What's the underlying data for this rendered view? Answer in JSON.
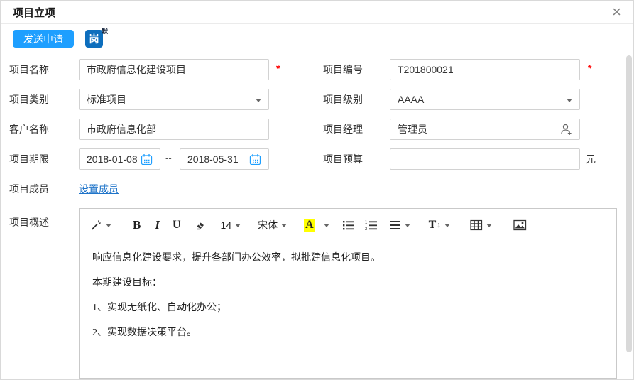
{
  "window": {
    "title": "项目立项",
    "close_icon": "×"
  },
  "toolbar": {
    "send_label": "发送申请",
    "post_icon_char": "岗",
    "post_icon_badge": "默"
  },
  "form": {
    "name": {
      "label": "项目名称",
      "value": "市政府信息化建设项目",
      "required": "*"
    },
    "code": {
      "label": "项目编号",
      "value": "T201800021",
      "required": "*"
    },
    "category": {
      "label": "项目类别",
      "value": "标准项目"
    },
    "level": {
      "label": "项目级别",
      "value": "AAAA"
    },
    "customer": {
      "label": "客户名称",
      "value": "市政府信息化部"
    },
    "manager": {
      "label": "项目经理",
      "value": "管理员"
    },
    "period": {
      "label": "项目期限",
      "start": "2018-01-08",
      "separator": "--",
      "end": "2018-05-31"
    },
    "budget": {
      "label": "项目预算",
      "value": "",
      "unit": "元"
    },
    "members": {
      "label": "项目成员",
      "link": "设置成员"
    },
    "overview": {
      "label": "项目概述"
    }
  },
  "editor": {
    "toolbar": {
      "bold": "B",
      "italic": "I",
      "underline": "U",
      "font_size": "14",
      "font_family": "宋体",
      "color_letter": "A",
      "lineheight_letter": "T",
      "lineheight_arrow": "↕"
    },
    "content": [
      "响应信息化建设要求，提升各部门办公效率，拟批建信息化项目。",
      "本期建设目标：",
      "1、实现无纸化、自动化办公；",
      "2、实现数据决策平台。"
    ]
  },
  "icons": {
    "wand": "magic-wand-icon",
    "eraser": "eraser-icon",
    "bullet": "bullet-list-icon",
    "numbered": "numbered-list-icon",
    "align": "align-icon",
    "table": "table-icon",
    "image": "image-icon",
    "calendar": "calendar-icon",
    "person_add": "person-add-icon"
  },
  "colors": {
    "accent": "#1E9FFF",
    "post_icon_blue": "#0d6ebd",
    "link": "#1f74c9",
    "required": "#ff0000",
    "highlight_yellow": "#ffff00",
    "border": "#d2d2d2"
  }
}
